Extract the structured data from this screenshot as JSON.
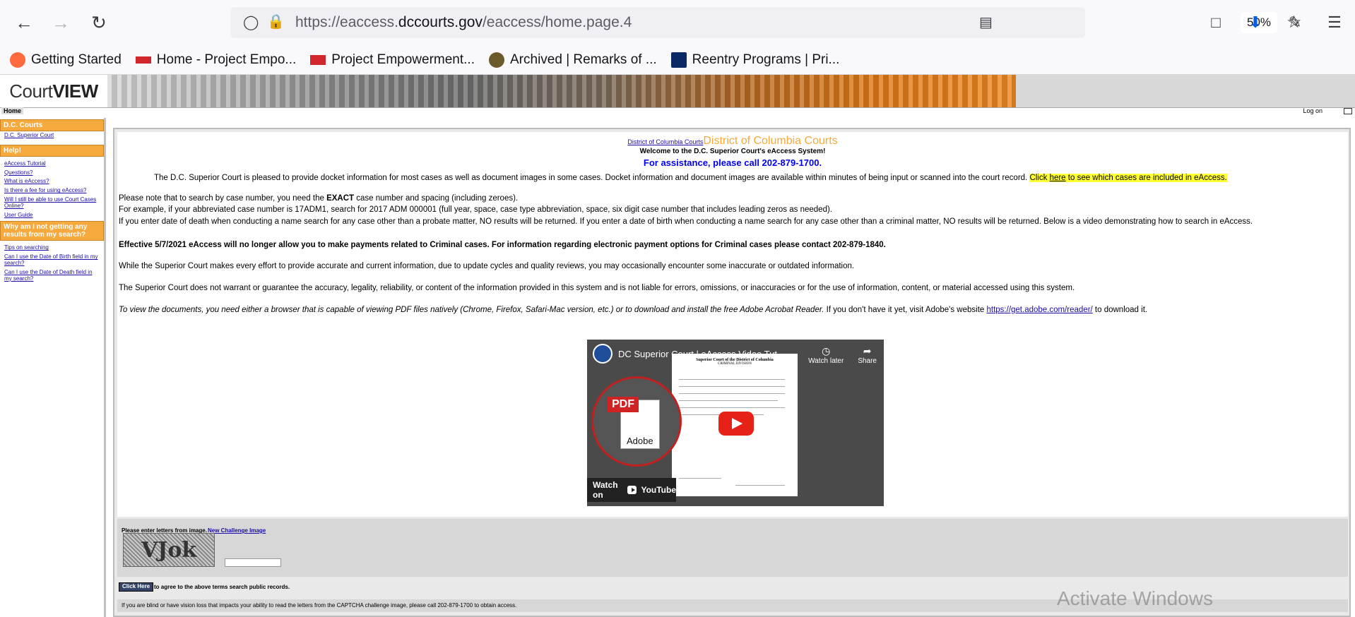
{
  "browser": {
    "url_prefix": "https://eaccess.",
    "url_domain": "dccourts.gov",
    "url_suffix": "/eaccess/home.page.4",
    "zoom": "50%",
    "bookmarks": [
      {
        "label": "Getting Started",
        "color": "#ff6a3d"
      },
      {
        "label": "Home - Project Empo...",
        "color": "#d2262d"
      },
      {
        "label": "Project Empowerment...",
        "color": "#d2262d"
      },
      {
        "label": "Archived | Remarks of ...",
        "color": "#6b5a2b"
      },
      {
        "label": "Reentry Programs | Pri...",
        "color": "#0b2a63"
      }
    ]
  },
  "header": {
    "logo_court": "Court",
    "logo_view": "VIEW",
    "home": "Home",
    "logon": "Log on"
  },
  "sidebar": {
    "sections": [
      {
        "title": "D.C. Courts",
        "links": [
          "D.C. Superior Court"
        ]
      },
      {
        "title": "Help!",
        "links": [
          "eAccess Tutorial",
          "Questions?",
          "What is eAccess?",
          "Is there a fee for using eAccess?",
          "Will I still be able to use Court Cases Online?",
          "User Guide"
        ]
      },
      {
        "title": "Why am I not getting any results from my search?",
        "links": [
          "Tips on searching",
          "Can I use the Date of Birth field in my search?",
          "Can I use the Date of Death field in my search?"
        ]
      }
    ]
  },
  "main": {
    "dcc_link": "District of Columbia Courts",
    "dcc_title": "District of Columbia Courts",
    "welcome": "Welcome to the D.C. Superior Court's eAccess System!",
    "assistance": "For assistance, please call 202-879-1700.",
    "intro_main": "The D.C. Superior Court is pleased to provide docket information for most cases as well as document images in some cases.  Docket information and document images are available within minutes of being input or scanned into the court record.",
    "intro_hl_pre": "Click ",
    "intro_hl_link": "here",
    "intro_hl_post": " to see which cases are included in eAccess.",
    "exact_pre": "Please note that to search by case number, you need the ",
    "exact_bold": "EXACT",
    "exact_post": " case number and spacing (including zeroes).",
    "example": "For example, if your abbreviated case number is 17ADM1, search for 2017 ADM 000001 (full year, space, case type abbreviation, space, six digit case number that includes leading zeros as needed).",
    "dates": "If you enter date of death when conducting a name search for any case other than a probate matter, NO results will be returned.  If you enter a date of birth when conducting a name search for any case other than a criminal matter, NO results will be returned.  Below is a video demonstrating how to search in eAccess.",
    "payments": "Effective 5/7/2021 eAccess will no longer allow you to make payments related to Criminal cases. For information regarding electronic payment options for Criminal cases please contact 202-879-1840.",
    "accuracy": "While the Superior Court makes every effort to provide accurate and current information, due to update cycles and quality reviews, you may occasionally encounter some inaccurate or outdated information.",
    "warranty": "The Superior Court does not warrant or guarantee the accuracy, legality, reliability, or content of the information provided in this system and is not liable for errors, omissions, or inaccuracies or for the use of information, content, or material accessed using this system.",
    "pdf_italic": "To view the documents, you need either a browser that is capable of viewing PDF files natively (Chrome, Firefox, Safari-Mac version, etc.) or to download and install the free Adobe Acrobat Reader.",
    "pdf_plain": " If you don't have it yet, visit Adobe's website  ",
    "pdf_link": "https://get.adobe.com/reader/",
    "pdf_end": " to download it."
  },
  "video": {
    "title": "DC Superior Court | eAccess Video Tut...",
    "watch_later": "Watch later",
    "share": "Share",
    "watch_on": "Watch on",
    "youtube": "YouTube",
    "pdf_tag": "PDF",
    "adobe": "Adobe",
    "doc_heading": "Superior Court of the District of Columbia",
    "doc_sub": "CRIMINAL DIVISION"
  },
  "captcha": {
    "label": "Please enter letters from image.",
    "new_challenge": "New Challenge Image",
    "image_text": "VJok",
    "agree_button": "Click Here",
    "agree_text": "to agree to the above terms search public records.",
    "blind_note": "If you are blind or have vision loss that impacts your ability to read the letters from the CAPTCHA challenge image, please call 202-879-1700 to obtain access."
  },
  "watermark": "Activate Windows"
}
